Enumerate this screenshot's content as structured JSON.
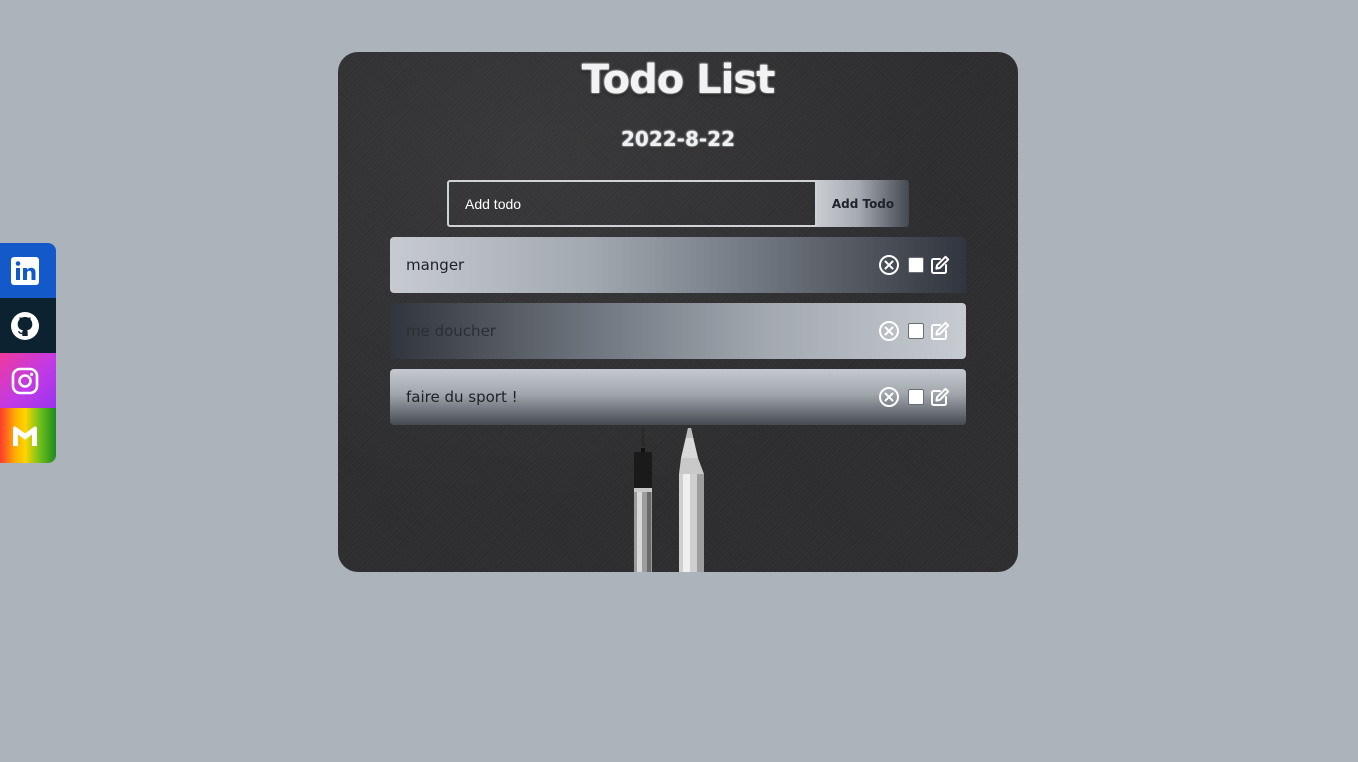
{
  "social": {
    "items": [
      {
        "icon": "linkedin-icon",
        "color": "#1459c9"
      },
      {
        "icon": "github-icon",
        "color": "#0d2230"
      },
      {
        "icon": "instagram-icon",
        "color": "#c13ae6"
      },
      {
        "icon": "gmail-icon",
        "color": "#ffb000"
      }
    ]
  },
  "app": {
    "title": "Todo List",
    "date": "2022-8-22",
    "add_placeholder": "Add todo",
    "add_button_label": "Add Todo"
  },
  "todos": [
    {
      "text": "manger",
      "done": false
    },
    {
      "text": "me doucher",
      "done": false
    },
    {
      "text": "faire du sport !",
      "done": false
    }
  ],
  "colors": {
    "page_background": "#adb3ba",
    "card_background": "#2e2e30",
    "linkedin": "#1459c9",
    "github": "#0d2230"
  }
}
